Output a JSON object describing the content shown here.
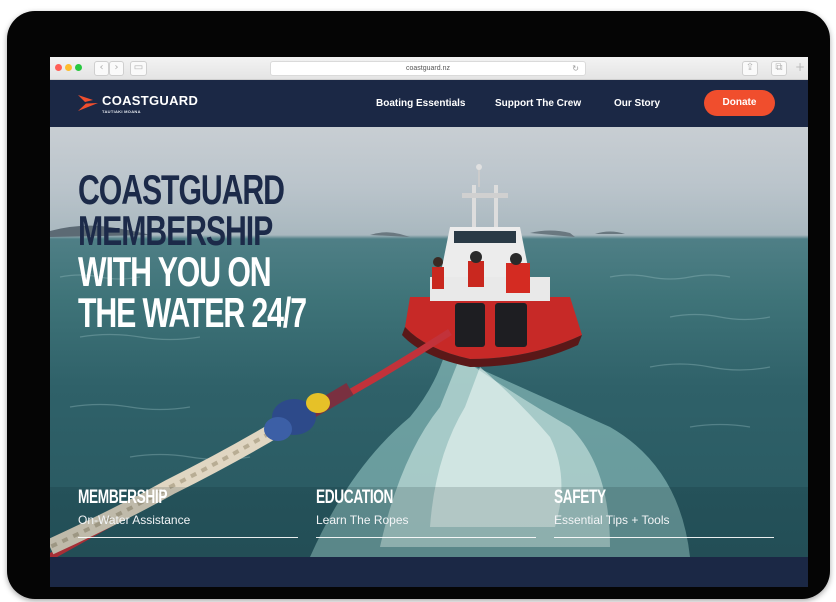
{
  "browser": {
    "url": "coastguard.nz",
    "back_glyph": "‹",
    "forward_glyph": "›",
    "sidebar_glyph": "▭",
    "reload_glyph": "↻",
    "share_glyph": "⇪",
    "tabs_glyph": "⧉",
    "newtab_glyph": "+"
  },
  "site": {
    "brand": "COASTGUARD",
    "brand_sub": "TAUTIAKI MOANA",
    "brand_color": "#f04e2d",
    "nav": {
      "items": [
        "Boating Essentials",
        "Support The Crew",
        "Our Story"
      ],
      "donate": "Donate"
    }
  },
  "hero": {
    "headline_dark": [
      "COASTGUARD",
      "MEMBERSHIP"
    ],
    "headline_light": [
      "WITH YOU ON",
      "THE WATER 24/7"
    ],
    "cards": [
      {
        "title": "MEMBERSHIP",
        "subtitle": "On-Water Assistance"
      },
      {
        "title": "EDUCATION",
        "subtitle": "Learn The Ropes"
      },
      {
        "title": "SAFETY",
        "subtitle": "Essential Tips + Tools"
      }
    ]
  }
}
